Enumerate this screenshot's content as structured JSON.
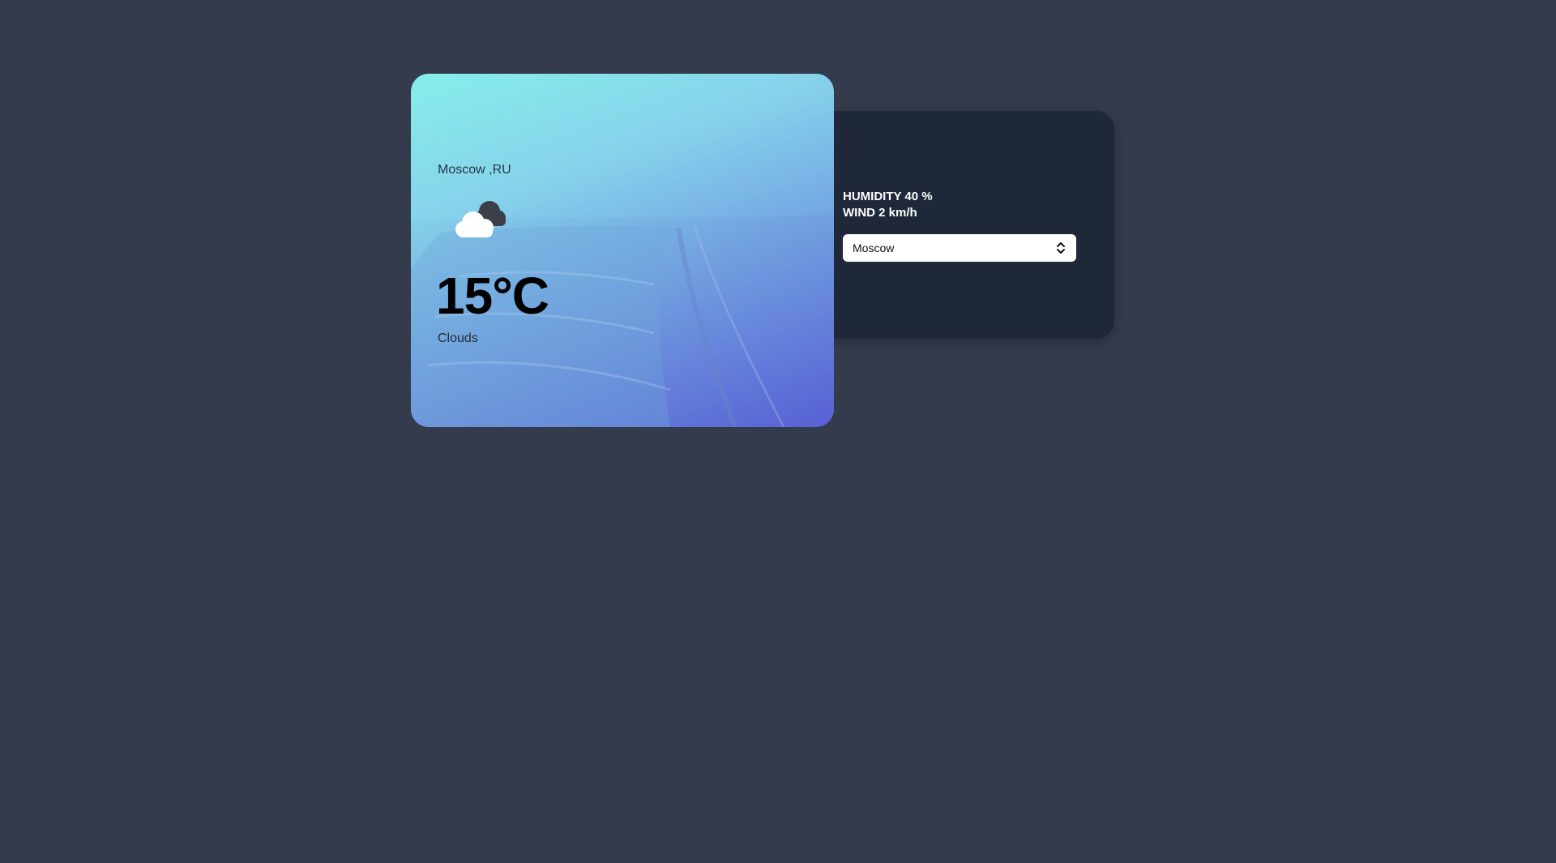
{
  "weather": {
    "location": "Moscow ,RU",
    "icon": "cloud-icon",
    "temperature": "15°C",
    "condition": "Clouds"
  },
  "details": {
    "humidity": "HUMIDITY 40 %",
    "wind": "WIND 2 km/h"
  },
  "city_select": {
    "selected": "Moscow",
    "icon": "chevron-up-down-icon"
  },
  "colors": {
    "page_background": "#343b4d",
    "panel_background": "#1f2839",
    "card_gradient_start": "#86eee9",
    "card_gradient_end": "#5a63d6"
  }
}
